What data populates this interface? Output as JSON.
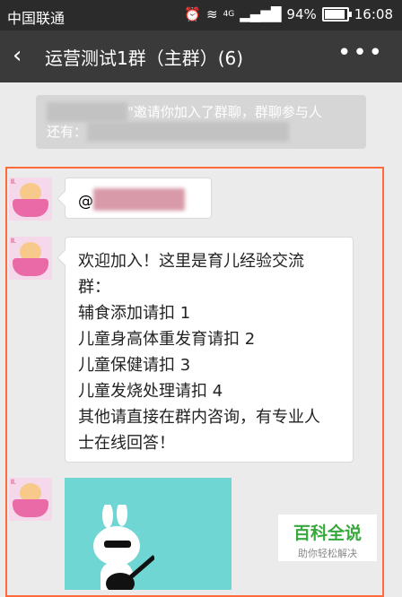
{
  "status_bar": {
    "carrier": "中国联通",
    "network": "4G",
    "battery": "94%",
    "battery_level": 0.94,
    "time": "16:08"
  },
  "header": {
    "title": "运营测试1群（主群）(6)"
  },
  "system_message": {
    "text_part1": "\"邀请你加入了群聊，群聊参与人",
    "text_part2": "还有："
  },
  "messages": [
    {
      "type": "text",
      "lines": [
        "@"
      ]
    },
    {
      "type": "text",
      "lines": [
        "欢迎加入！这里是育儿经验交流",
        "群：",
        "辅食添加请扣 1",
        "儿童身高体重发育请扣 2",
        "儿童保健请扣 3",
        "儿童发烧处理请扣 4",
        "其他请直接在群内咨询，有专业人",
        "士在线回答！"
      ]
    }
  ],
  "watermark": {
    "title": "百科全说",
    "subtitle": "助你轻松解决"
  },
  "colors": {
    "highlight": "#ff6a3d",
    "title_bar": "#3a3a3a",
    "status_bar": "#2b2b2b",
    "brand_green": "#37a93c"
  }
}
